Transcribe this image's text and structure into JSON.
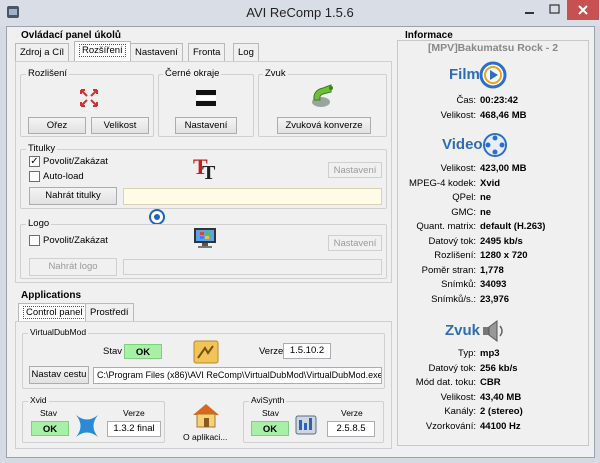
{
  "window": {
    "title": "AVI ReComp  1.5.6"
  },
  "tasks": {
    "heading": "Ovládací panel úkolů",
    "tabs": [
      {
        "label": "Zdroj a Cíl"
      },
      {
        "label": "Rozšíření"
      },
      {
        "label": "Nastavení"
      },
      {
        "label": "Fronta"
      },
      {
        "label": "Log"
      }
    ],
    "resolution": {
      "label": "Rozlišení",
      "crop_btn": "Ořez",
      "size_btn": "Velikost"
    },
    "borders": {
      "label": "Černé okraje",
      "settings_btn": "Nastavení"
    },
    "sound": {
      "label": "Zvuk",
      "convert_btn": "Zvuková konverze"
    },
    "subtitles": {
      "label": "Titulky",
      "enable": "Povolit/Zakázat",
      "enable_checked": "✓",
      "autoload": "Auto-load",
      "settings_btn": "Nastavení",
      "load_btn": "Nahrát titulky",
      "path": ""
    },
    "logo": {
      "label": "Logo",
      "enable": "Povolit/Zakázat",
      "settings_btn": "Nastavení",
      "load_btn": "Nahrát logo",
      "path": ""
    }
  },
  "applications": {
    "heading": "Applications",
    "tabs": [
      {
        "label": "Control panel"
      },
      {
        "label": "Prostředí"
      }
    ],
    "virtualdub": {
      "label": "VirtualDubMod",
      "status_label": "Stav",
      "status": "OK",
      "version_label": "Verze",
      "version": "1.5.10.2",
      "path_btn": "Nastav cestu",
      "path": "C:\\Program Files (x86)\\AVI ReComp\\VirtualDubMod\\VirtualDubMod.exe"
    },
    "xvid": {
      "label": "Xvid",
      "status_label": "Stav",
      "status": "OK",
      "version_label": "Verze",
      "version": "1.3.2 final"
    },
    "about": {
      "label": "O aplikaci..."
    },
    "avisynth": {
      "label": "AviSynth",
      "status_label": "Stav",
      "status": "OK",
      "version_label": "Verze",
      "version": "2.5.8.5"
    }
  },
  "info": {
    "heading": "Informace",
    "filename": "[MPV]Bakumatsu Rock - 2",
    "film": {
      "title": "Film",
      "rows": [
        {
          "label": "Čas:",
          "value": "00:23:42"
        },
        {
          "label": "Velikost:",
          "value": "468,46 MB"
        }
      ]
    },
    "video": {
      "title": "Video",
      "rows": [
        {
          "label": "Velikost:",
          "value": "423,00 MB"
        },
        {
          "label": "MPEG-4 kodek:",
          "value": "Xvid"
        },
        {
          "label": "QPel:",
          "value": "ne"
        },
        {
          "label": "GMC:",
          "value": "ne"
        },
        {
          "label": "Quant. matrix:",
          "value": "default (H.263)"
        },
        {
          "label": "Datový tok:",
          "value": "2495 kb/s"
        },
        {
          "label": "Rozlišení:",
          "value": "1280 x 720"
        },
        {
          "label": "Poměr stran:",
          "value": "1,778"
        },
        {
          "label": "Snímků:",
          "value": "34093"
        },
        {
          "label": "Snímků/s.:",
          "value": "23,976"
        }
      ]
    },
    "audio": {
      "title": "Zvuk",
      "rows": [
        {
          "label": "Typ:",
          "value": "mp3"
        },
        {
          "label": "Datový tok:",
          "value": "256 kb/s"
        },
        {
          "label": "Mód dat. toku:",
          "value": "CBR"
        },
        {
          "label": "Velikost:",
          "value": "43,40 MB"
        },
        {
          "label": "Kanály:",
          "value": "2 (stereo)"
        },
        {
          "label": "Vzorkování:",
          "value": "44100 Hz"
        }
      ]
    }
  },
  "colors": {
    "ok": "#a8f0a8",
    "info_heading": "#2f6db5",
    "close_button": "#c75050"
  },
  "icons": [
    "app-icon",
    "minimize-icon",
    "maximize-icon",
    "close-icon",
    "crop-arrows-icon",
    "black-bars-icon",
    "audio-convert-icon",
    "subtitles-tt-icon",
    "logo-monitor-icon",
    "virtualdub-icon",
    "xvid-icon",
    "about-house-icon",
    "avisynth-icon",
    "film-play-icon",
    "video-film-icon",
    "speaker-icon",
    "target-cursor-icon"
  ]
}
